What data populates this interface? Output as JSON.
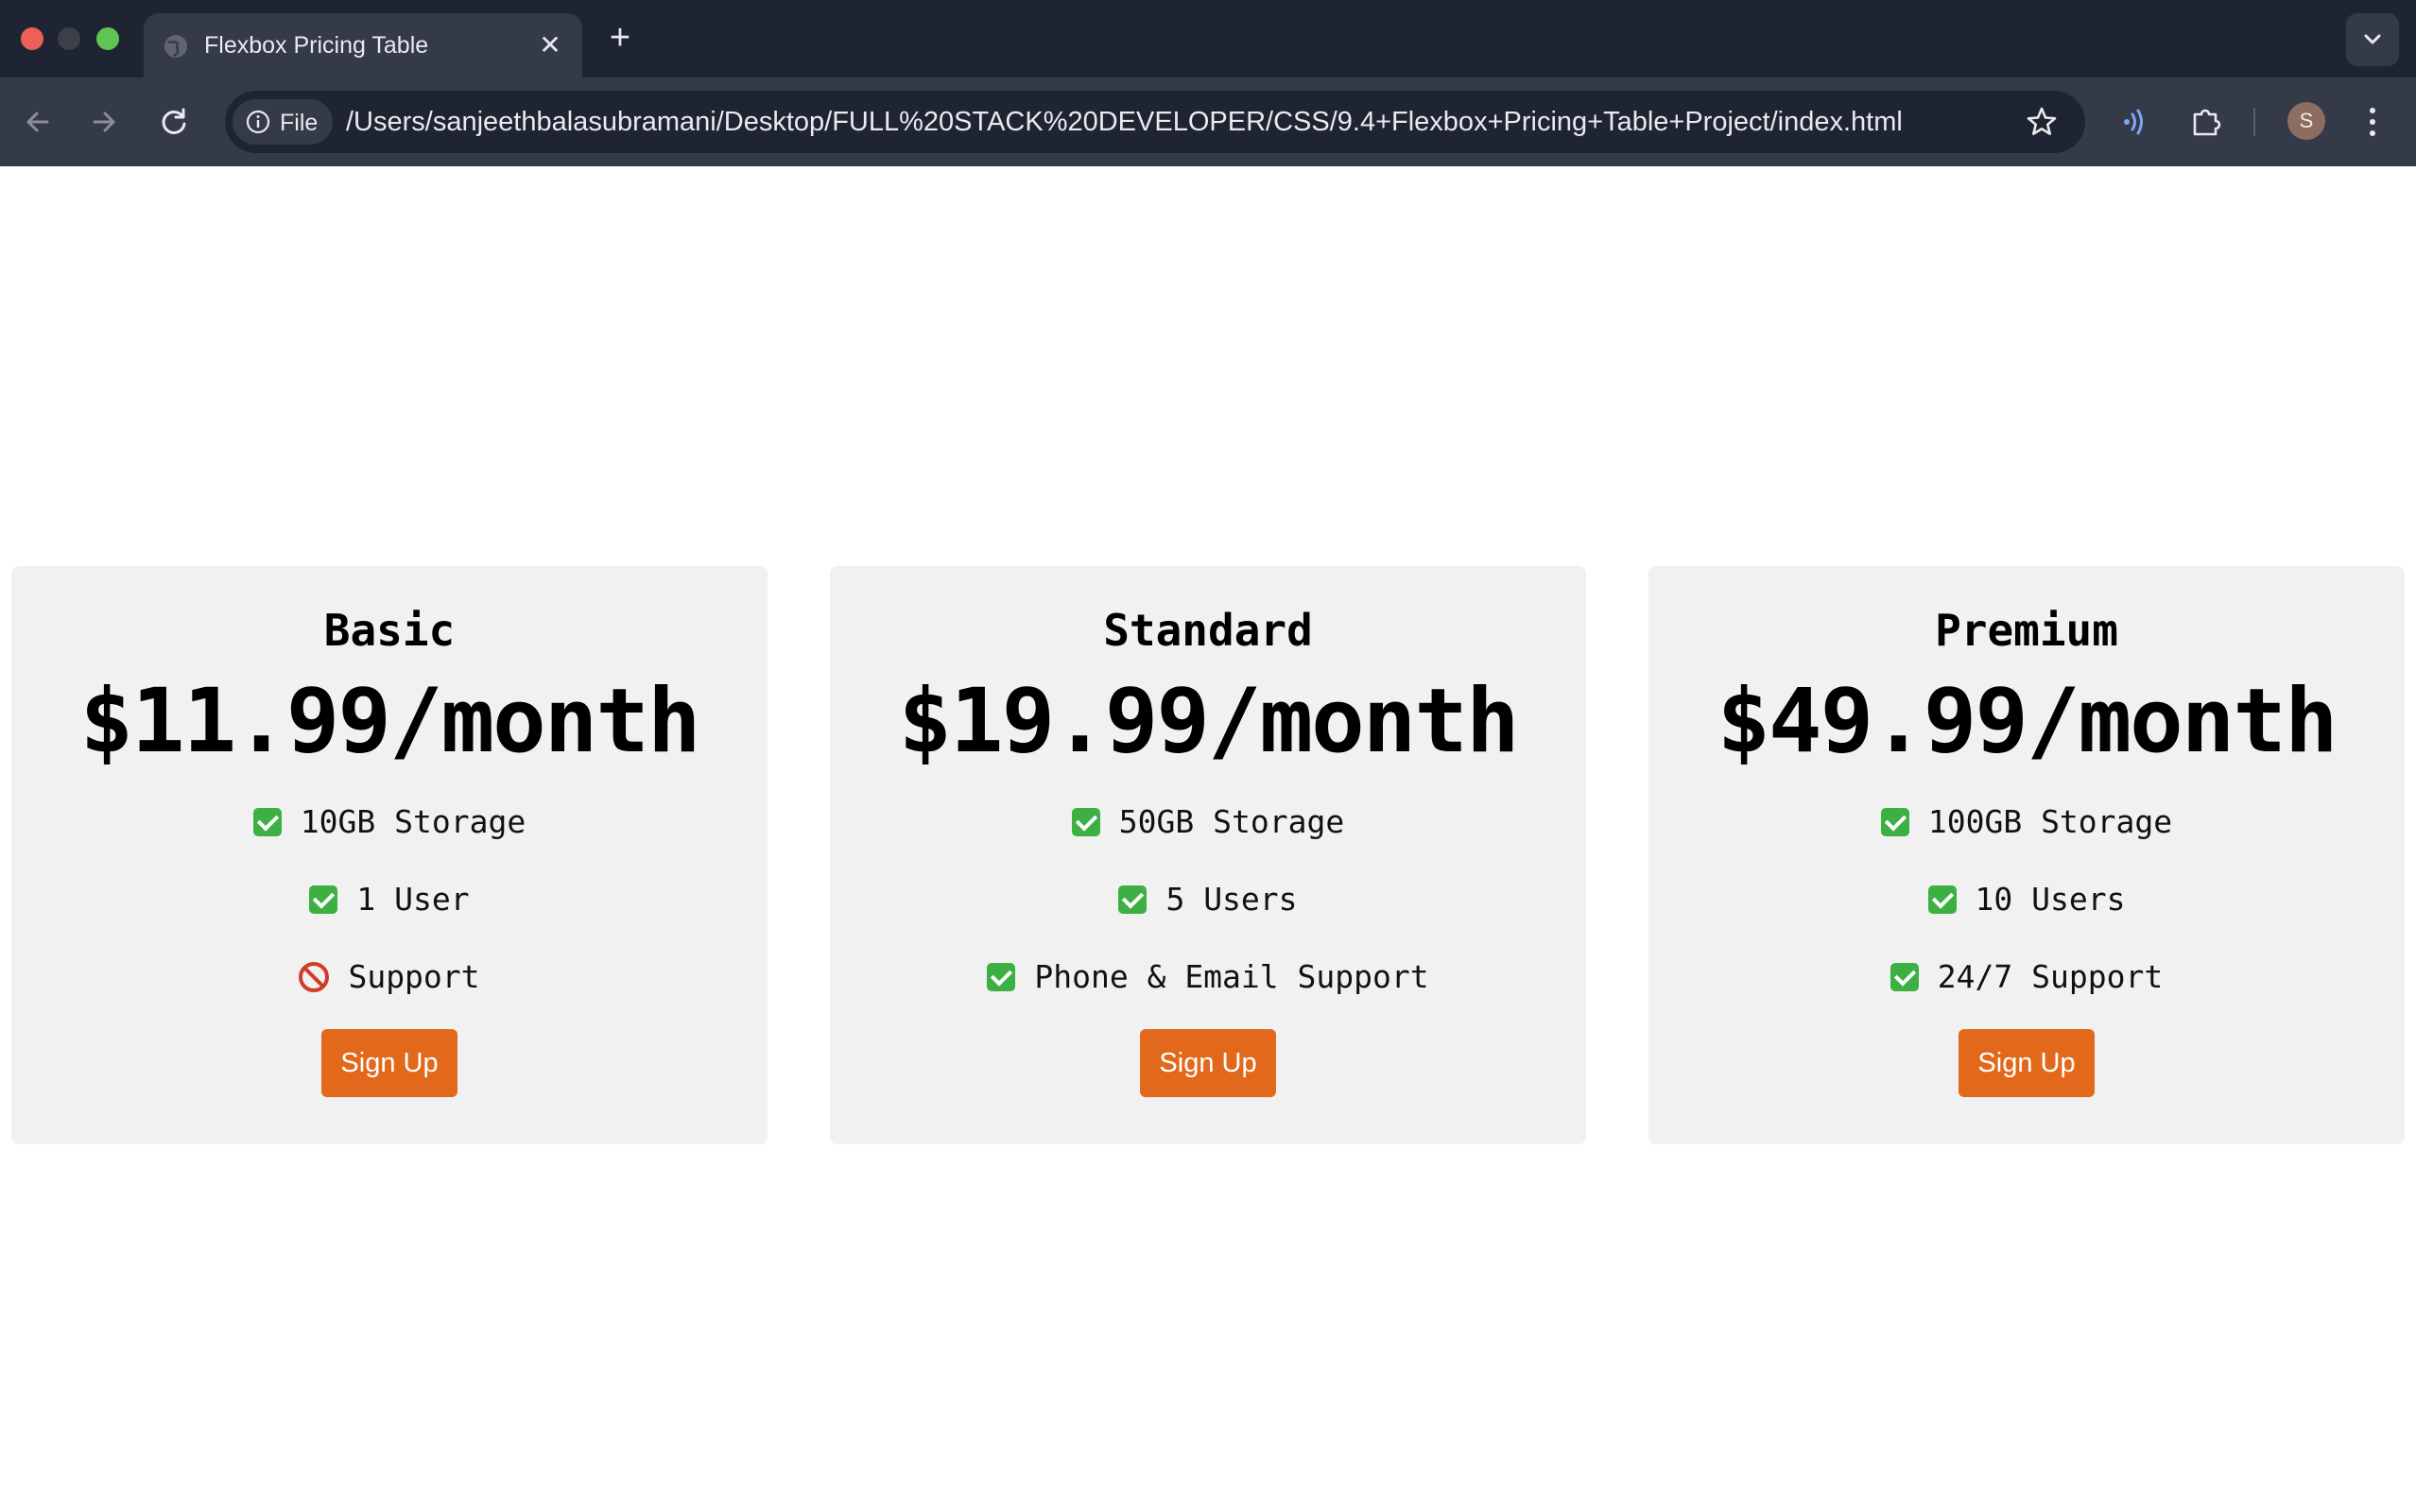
{
  "browser": {
    "tab_title": "Flexbox Pricing Table",
    "file_chip_label": "File",
    "url": "/Users/sanjeethbalasubramani/Desktop/FULL%20STACK%20DEVELOPER/CSS/9.4+Flexbox+Pricing+Table+Project/index.html",
    "avatar_initial": "S"
  },
  "plans": [
    {
      "name": "Basic",
      "price": "$11.99/month",
      "features": [
        {
          "icon": "check-icon",
          "label": "10GB Storage"
        },
        {
          "icon": "check-icon",
          "label": "1 User"
        },
        {
          "icon": "prohibited-icon",
          "label": "Support"
        }
      ],
      "cta": "Sign Up"
    },
    {
      "name": "Standard",
      "price": "$19.99/month",
      "features": [
        {
          "icon": "check-icon",
          "label": "50GB Storage"
        },
        {
          "icon": "check-icon",
          "label": "5 Users"
        },
        {
          "icon": "check-icon",
          "label": "Phone & Email Support"
        }
      ],
      "cta": "Sign Up"
    },
    {
      "name": "Premium",
      "price": "$49.99/month",
      "features": [
        {
          "icon": "check-icon",
          "label": "100GB Storage"
        },
        {
          "icon": "check-icon",
          "label": "10 Users"
        },
        {
          "icon": "check-icon",
          "label": "24/7 Support"
        }
      ],
      "cta": "Sign Up"
    }
  ],
  "colors": {
    "card_bg": "#f1f1f1",
    "button_bg": "#e2691c",
    "check": "#3cb043",
    "prohibited": "#d13b2a",
    "chrome_dark": "#1f2433",
    "chrome_toolbar": "#353a48"
  }
}
